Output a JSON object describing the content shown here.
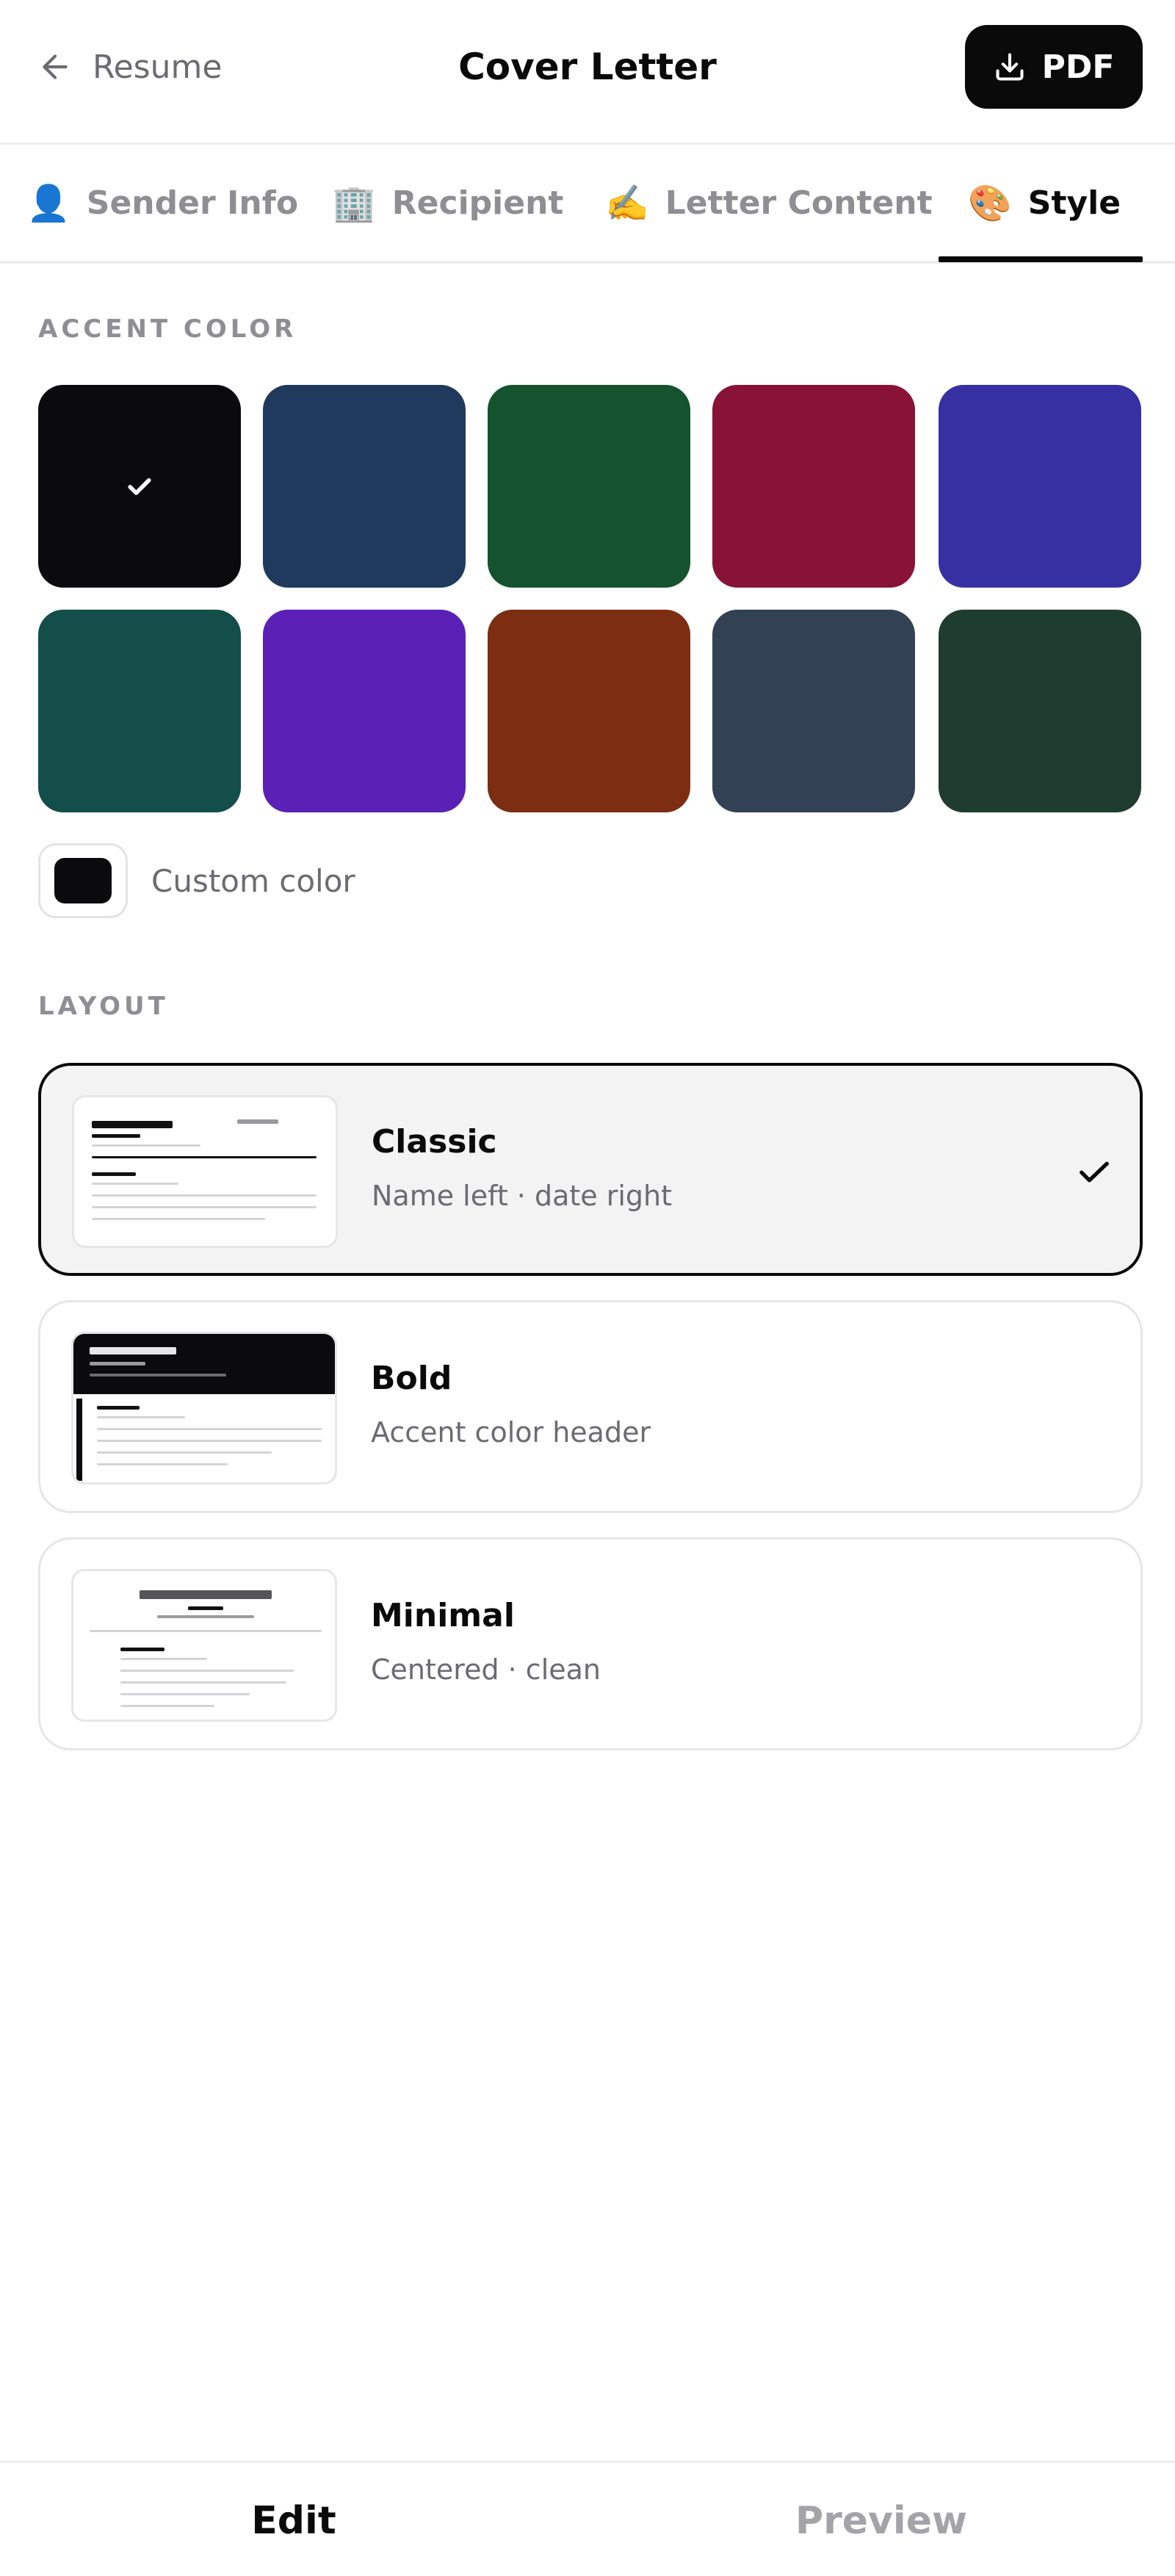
{
  "header": {
    "back_label": "Resume",
    "title": "Cover Letter",
    "pdf_label": "PDF"
  },
  "tabs": [
    {
      "icon": "👤",
      "icon_name": "person-icon",
      "label": "Sender Info",
      "active": false
    },
    {
      "icon": "🏢",
      "icon_name": "office-building-icon",
      "label": "Recipient",
      "active": false
    },
    {
      "icon": "✍️",
      "icon_name": "writing-hand-icon",
      "label": "Letter Content",
      "active": false
    },
    {
      "icon": "🎨",
      "icon_name": "palette-icon",
      "label": "Style",
      "active": true
    }
  ],
  "accent": {
    "label": "ACCENT COLOR",
    "selected": "#0b0b0d",
    "colors": [
      "#0b0b0d",
      "#1f3a5c",
      "#14532d",
      "#881337",
      "#3730a3",
      "#134e4a",
      "#5b21b6",
      "#7c2d12",
      "#334155",
      "#1f3d2e"
    ],
    "custom_label": "Custom color",
    "custom_value": "#0b0b0d"
  },
  "layout": {
    "label": "LAYOUT",
    "options": [
      {
        "name": "Classic",
        "description": "Name left · date right",
        "selected": true
      },
      {
        "name": "Bold",
        "description": "Accent color header",
        "selected": false
      },
      {
        "name": "Minimal",
        "description": "Centered · clean",
        "selected": false
      }
    ]
  },
  "bottom_nav": {
    "edit_label": "Edit",
    "preview_label": "Preview",
    "active": "Edit"
  }
}
